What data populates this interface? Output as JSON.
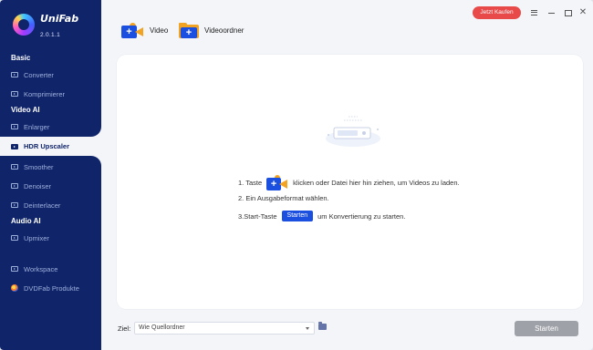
{
  "app": {
    "name": "UniFab",
    "version": "2.0.1.1"
  },
  "header": {
    "add_video_label": "Video",
    "add_folder_label": "Videoordner",
    "buy_button": "Jetzt Kaufen"
  },
  "sidebar": {
    "sections": {
      "basic": "Basic",
      "video_ai": "Video AI",
      "audio_ai": "Audio AI"
    },
    "items": {
      "converter": "Converter",
      "compressor": "Komprimierer",
      "enlarger": "Enlarger",
      "hdr_upscaler": "HDR Upscaler",
      "smoother": "Smoother",
      "denoiser": "Denoiser",
      "deinterlacer": "Deinterlacer",
      "upmixer": "Upmixer",
      "workspace": "Workspace",
      "dvdfab": "DVDFab Produkte"
    },
    "active_item": "HDR Upscaler"
  },
  "instructions": {
    "step1_prefix": "1. Taste",
    "step1_suffix": "klicken oder Datei hier hin ziehen, um Videos zu laden.",
    "step2": "2. Ein Ausgabeformat wählen.",
    "step3_prefix": "3.Start-Taste",
    "step3_chip": "Starten",
    "step3_suffix": "um Konvertierung zu starten."
  },
  "footer": {
    "target_label": "Ziel:",
    "target_value": "Wie Quellordner",
    "start_button": "Starten"
  },
  "colors": {
    "sidebar_bg": "#10246a",
    "accent_blue": "#1b4fe0",
    "accent_orange": "#f2a322",
    "buy_red": "#e84a4a",
    "start_disabled": "#9ea1a8"
  }
}
